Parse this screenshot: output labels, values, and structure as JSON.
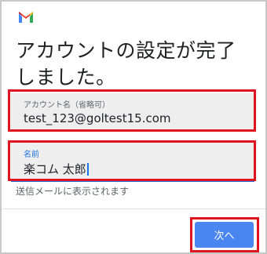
{
  "app": {
    "logo_icon": "gmail-logo-icon"
  },
  "title": "アカウントの設定が完了しました。",
  "fields": {
    "account_name": {
      "label": "アカウント名（省略可）",
      "value": "test_123@goltest15.com"
    },
    "name": {
      "label": "名前",
      "value": "楽コム 太郎"
    }
  },
  "hint": "送信メールに表示されます",
  "actions": {
    "next_label": "次へ"
  },
  "colors": {
    "accent": "#1a73e8",
    "button": "#4a86f0",
    "highlight": "#e0141e",
    "field_bg": "#eeeeee"
  }
}
